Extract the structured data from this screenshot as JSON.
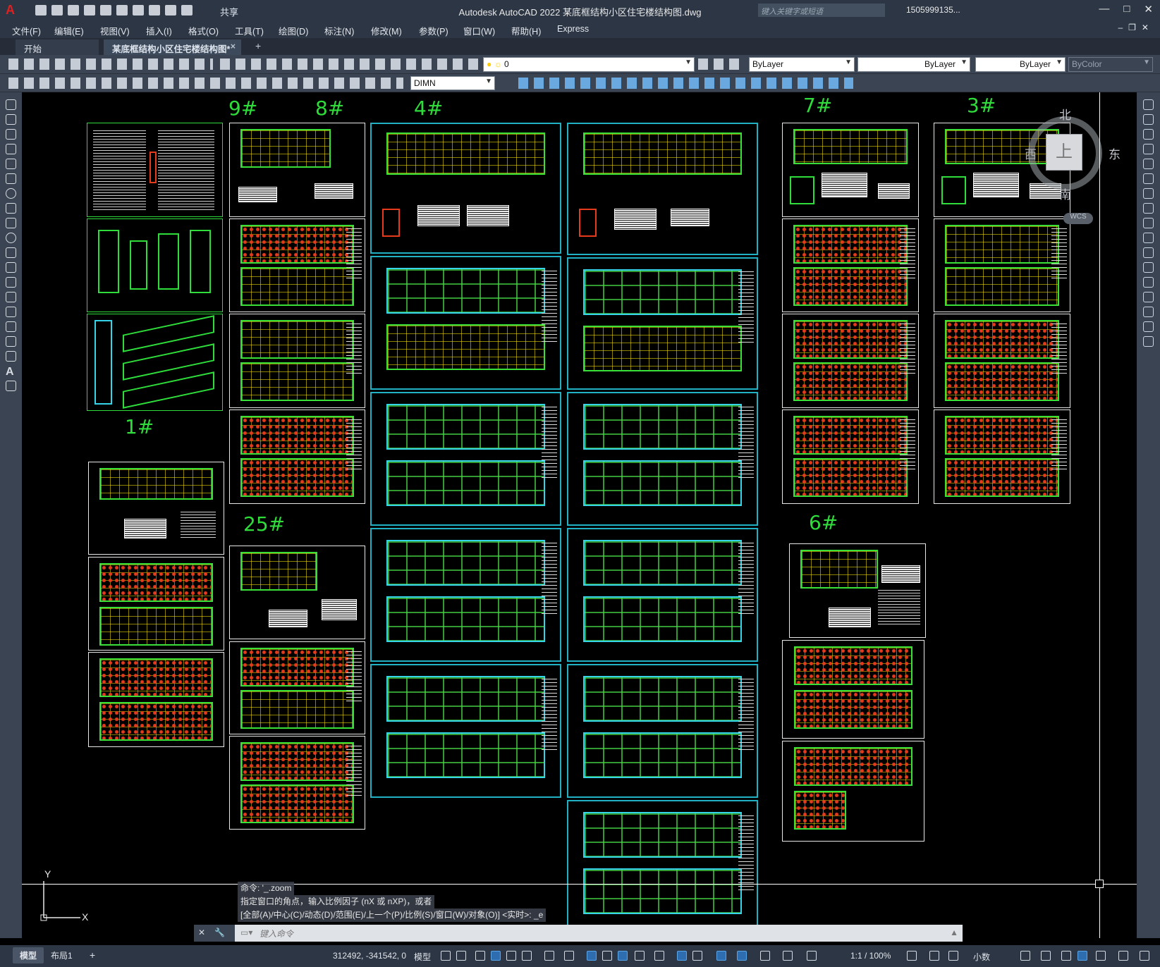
{
  "app": {
    "logo": "A",
    "title": "Autodesk AutoCAD 2022  某底框结构小区住宅楼结构图.dwg",
    "share_label": "共享",
    "search_placeholder": "键入关键字或短语",
    "user": "1505999135...",
    "colors": {
      "accent": "#20b2c4",
      "drawing_green": "#2edc3a",
      "titlebar": "#2d3644",
      "toolbar": "#3b4453"
    }
  },
  "menu": [
    "文件(F)",
    "编辑(E)",
    "视图(V)",
    "插入(I)",
    "格式(O)",
    "工具(T)",
    "绘图(D)",
    "标注(N)",
    "修改(M)",
    "参数(P)",
    "窗口(W)",
    "帮助(H)",
    "Express"
  ],
  "tabs": {
    "start": "开始",
    "doc": "某底框结构小区住宅楼结构图*",
    "close": "×",
    "new": "+"
  },
  "toolbar": {
    "layer": "0",
    "dimstyle": "DIMN",
    "color": "ByLayer",
    "linetype": "ByLayer",
    "lineweight": "ByLayer",
    "plotstyle": "ByColor"
  },
  "labels": [
    "9#",
    "8#",
    "4#",
    "7#",
    "3#",
    "1#",
    "25#",
    "6#"
  ],
  "viewcube": {
    "north": "北",
    "south": "南",
    "east": "东",
    "west": "西",
    "face": "上",
    "wcs": "WCS"
  },
  "ucs": {
    "x": "X",
    "y": "Y"
  },
  "command": {
    "history": [
      "命令: '_.zoom",
      "指定窗口的角点，输入比例因子 (nX 或 nXP)，或者",
      "[全部(A)/中心(C)/动态(D)/范围(E)/上一个(P)/比例(S)/窗口(W)/对象(O)] <实时>: _e"
    ],
    "placeholder": "键入命令"
  },
  "layouts": [
    "模型",
    "布局1",
    "+"
  ],
  "status": {
    "coords": "312492, -341542, 0",
    "model": "模型",
    "scale": "1:1 / 100%",
    "units": "小数"
  }
}
